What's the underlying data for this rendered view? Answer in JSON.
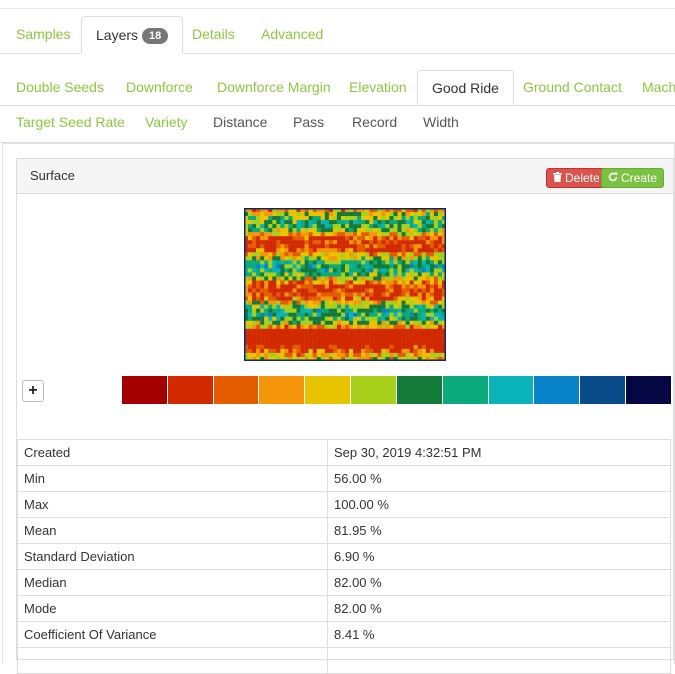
{
  "main_tabs": [
    {
      "label": "Samples"
    },
    {
      "label": "Layers",
      "badge": "18"
    },
    {
      "label": "Details"
    },
    {
      "label": "Advanced"
    }
  ],
  "sub_tabs_row1": [
    {
      "label": "Double Seeds"
    },
    {
      "label": "Downforce"
    },
    {
      "label": "Downforce Margin"
    },
    {
      "label": "Elevation"
    },
    {
      "label": "Good Ride"
    },
    {
      "label": "Ground Contact"
    },
    {
      "label": "Machi"
    }
  ],
  "sub_tabs_row2": [
    {
      "label": "Target Seed Rate"
    },
    {
      "label": "Variety"
    },
    {
      "label": "Distance"
    },
    {
      "label": "Pass"
    },
    {
      "label": "Record"
    },
    {
      "label": "Width"
    }
  ],
  "panel": {
    "title": "Surface",
    "delete_label": "Delete",
    "create_label": "Create"
  },
  "legend_colors": [
    "#a50000",
    "#d22a00",
    "#e35d00",
    "#f5960a",
    "#e8c400",
    "#a8cf1a",
    "#137a3a",
    "#0aaa7a",
    "#0ab3b8",
    "#0883c9",
    "#0a4c8a",
    "#040742"
  ],
  "stats": [
    {
      "key": "Created",
      "value": "Sep 30, 2019 4:32:51 PM"
    },
    {
      "key": "Min",
      "value": "56.00 %"
    },
    {
      "key": "Max",
      "value": "100.00 %"
    },
    {
      "key": "Mean",
      "value": "81.95 %"
    },
    {
      "key": "Standard Deviation",
      "value": "6.90 %"
    },
    {
      "key": "Median",
      "value": "82.00 %"
    },
    {
      "key": "Mode",
      "value": "82.00 %"
    },
    {
      "key": "Coefficient Of Variance",
      "value": "8.41 %"
    },
    {
      "key": "",
      "value": ""
    }
  ]
}
